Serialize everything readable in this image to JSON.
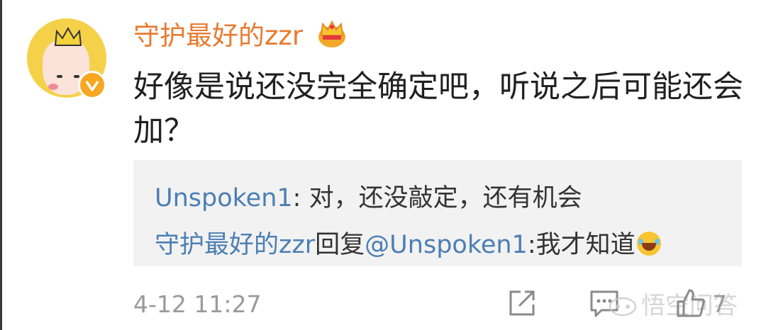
{
  "comment": {
    "username": "守护最好的zzr",
    "text": "好像是说还没完全确定吧，听说之后可能还会加？",
    "timestamp": "4-12 11:27",
    "like_count": "7"
  },
  "replies": [
    {
      "author": "Unspoken1",
      "sep": ": ",
      "text": "对，还没敲定，还有机会"
    },
    {
      "author": "守护最好的zzr",
      "verb": "回复",
      "mention": "@Unspoken1",
      "text": ":我才知道"
    }
  ],
  "watermark": "悟空问答",
  "icons": {
    "avatar": "avatar-image",
    "verified": "verified-badge-icon",
    "vip": "crown-vip-icon",
    "emoji": "laugh-cry-emoji-icon",
    "share": "share-icon",
    "comment": "comment-icon",
    "like": "thumb-up-icon"
  },
  "colors": {
    "username": "#e87a2f",
    "link": "#4c7fb3",
    "reply_bg": "#f2f2f2",
    "meta": "#9a9a9a",
    "badge": "#f7a721"
  }
}
